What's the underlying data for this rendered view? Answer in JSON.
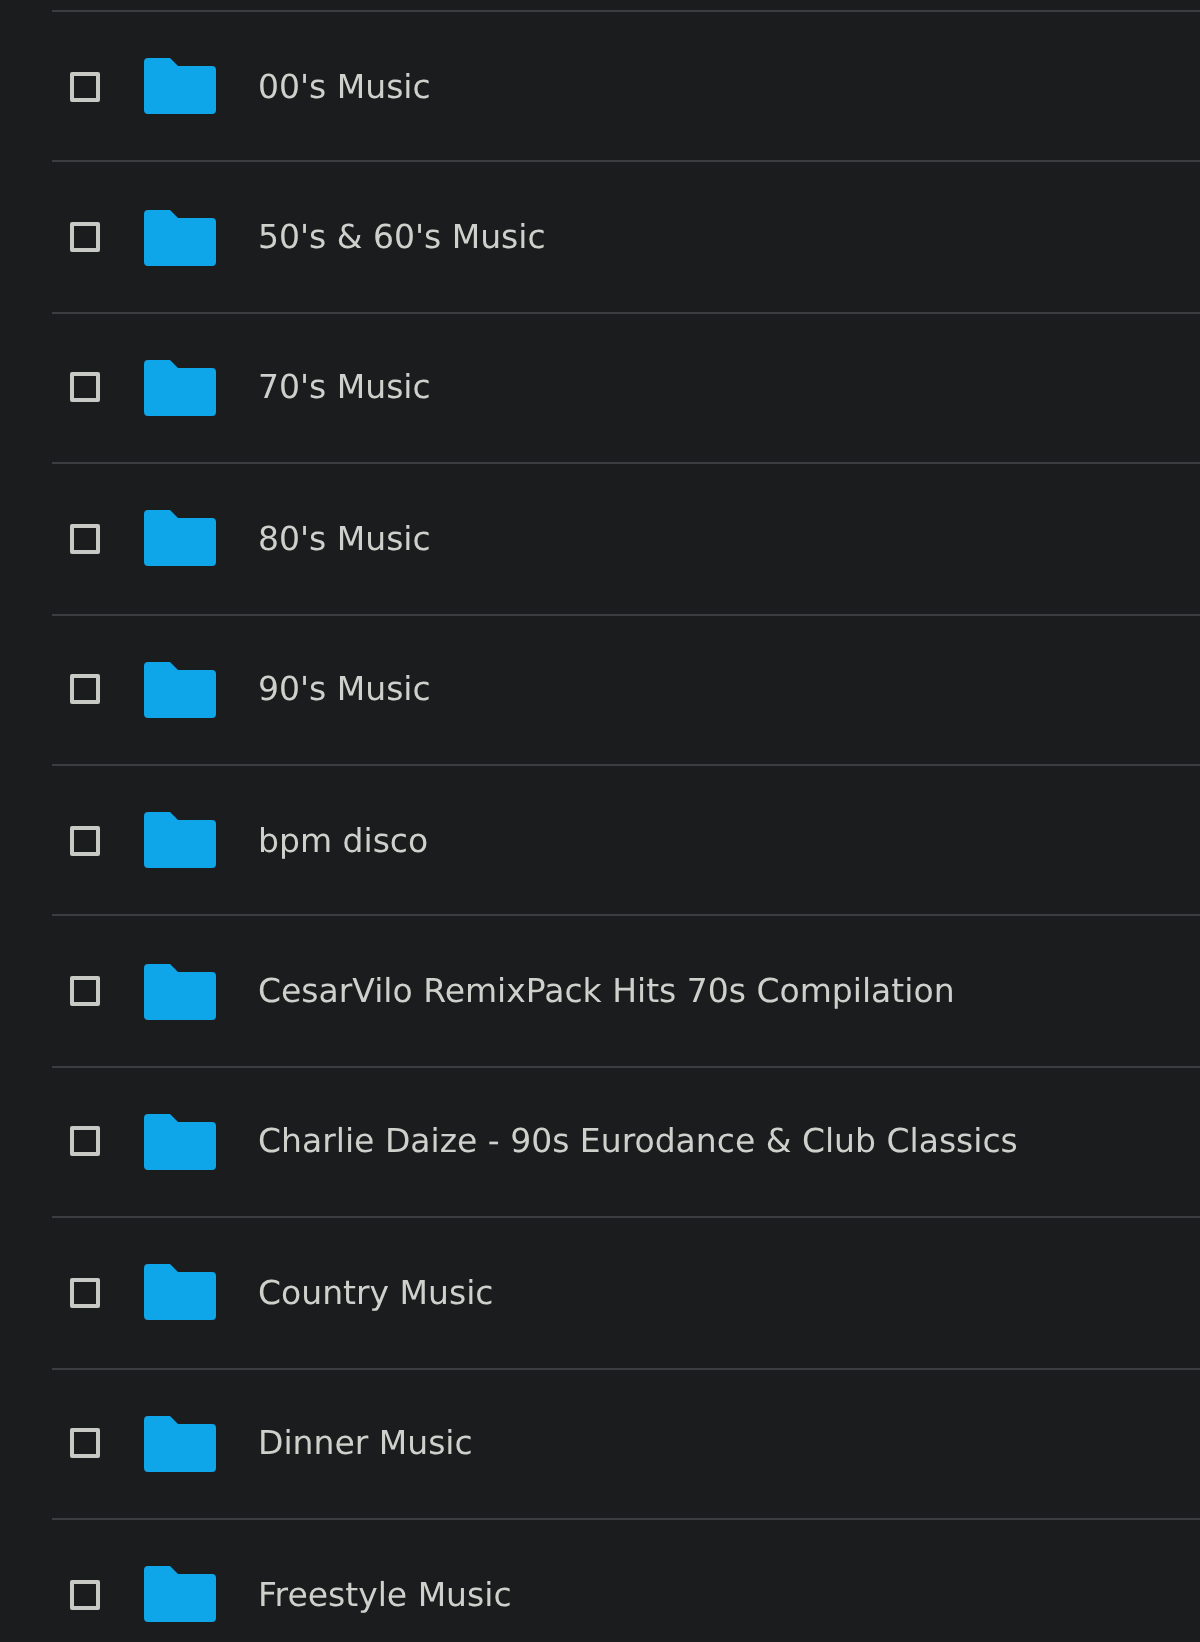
{
  "folders": [
    {
      "name": "00's Music",
      "checked": false
    },
    {
      "name": "50's & 60's Music",
      "checked": false
    },
    {
      "name": "70's Music",
      "checked": false
    },
    {
      "name": "80's Music",
      "checked": false
    },
    {
      "name": "90's Music",
      "checked": false
    },
    {
      "name": "bpm disco",
      "checked": false
    },
    {
      "name": "CesarVilo RemixPack Hits 70s Compilation",
      "checked": false
    },
    {
      "name": "Charlie Daize - 90s Eurodance & Club Classics",
      "checked": false
    },
    {
      "name": "Country Music",
      "checked": false
    },
    {
      "name": "Dinner Music",
      "checked": false
    },
    {
      "name": "Freestyle Music",
      "checked": false
    }
  ]
}
